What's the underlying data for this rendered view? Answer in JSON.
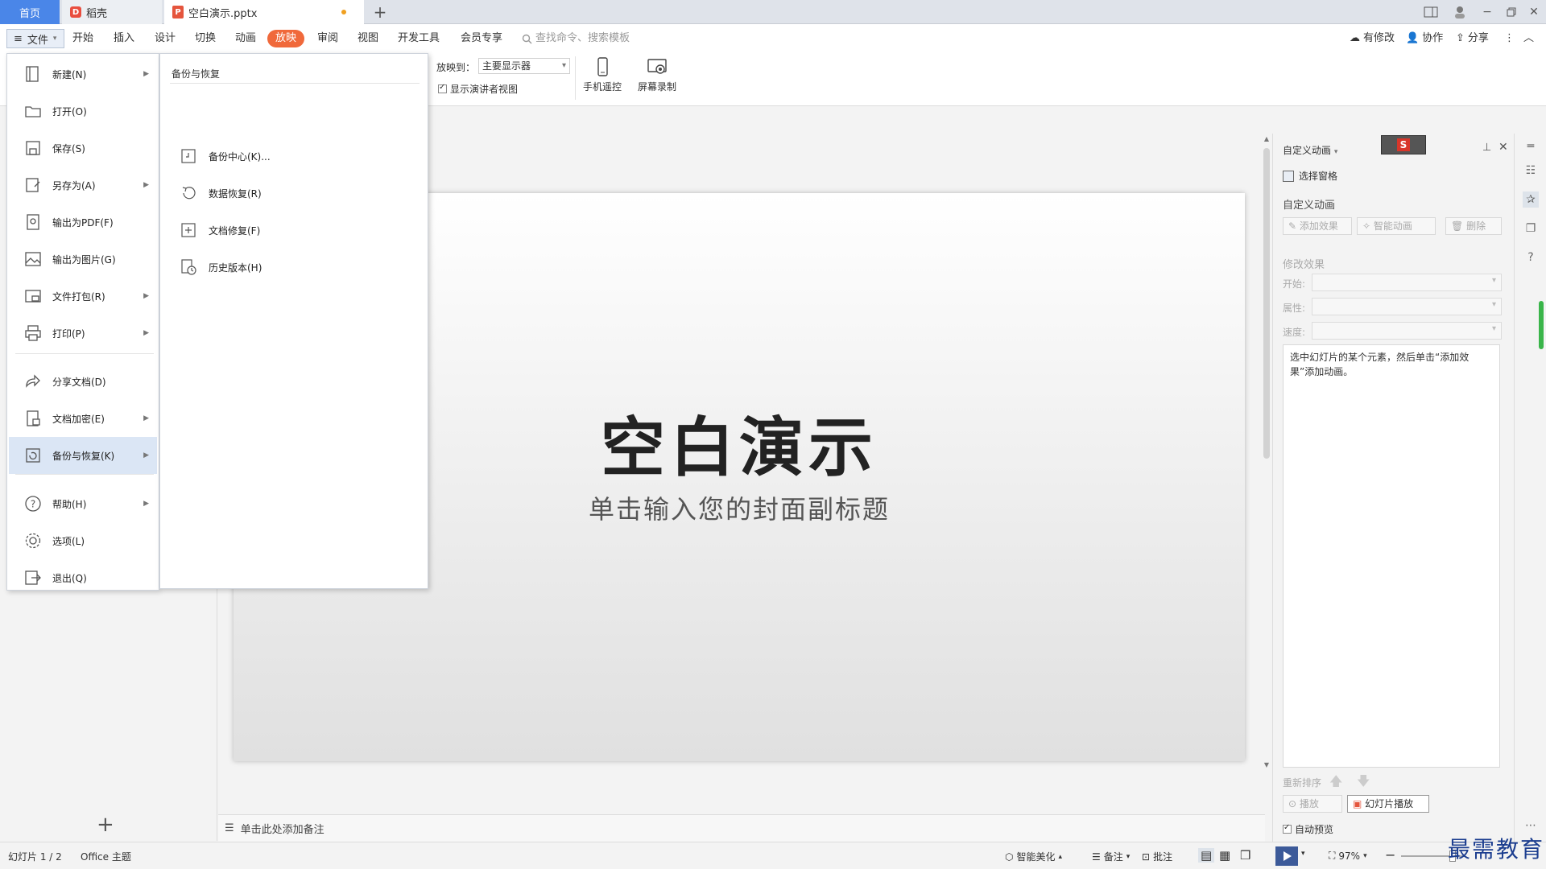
{
  "tabs": {
    "home": "首页",
    "daoke": "稻壳",
    "doc": "空白演示.pptx"
  },
  "menubar": {
    "file": "文件",
    "items": [
      "开始",
      "插入",
      "设计",
      "切换",
      "动画",
      "放映",
      "审阅",
      "视图",
      "开发工具",
      "会员专享"
    ],
    "active_index": 5,
    "search_placeholder": "查找命令、搜索模板",
    "right_actions": [
      "有修改",
      "协作",
      "分享"
    ]
  },
  "ribbon": {
    "project_to_label": "放映到：",
    "project_to_value": "主要显示器",
    "presenter_view_label": "显示演讲者视图",
    "phone_remote": "手机遥控",
    "screen_record": "屏幕录制"
  },
  "file_menu": {
    "items": [
      {
        "label": "新建(N)",
        "icon": "new-doc-icon",
        "has_sub": true
      },
      {
        "label": "打开(O)",
        "icon": "open-folder-icon",
        "has_sub": false
      },
      {
        "label": "保存(S)",
        "icon": "save-icon",
        "has_sub": false
      },
      {
        "label": "另存为(A)",
        "icon": "save-as-icon",
        "has_sub": true
      },
      {
        "label": "输出为PDF(F)",
        "icon": "pdf-icon",
        "has_sub": false
      },
      {
        "label": "输出为图片(G)",
        "icon": "image-icon",
        "has_sub": false
      },
      {
        "label": "文件打包(R)",
        "icon": "package-icon",
        "has_sub": true
      },
      {
        "label": "打印(P)",
        "icon": "print-icon",
        "has_sub": true
      },
      {
        "label": "分享文档(D)",
        "icon": "share-icon",
        "has_sub": false
      },
      {
        "label": "文档加密(E)",
        "icon": "lock-icon",
        "has_sub": true
      },
      {
        "label": "备份与恢复(K)",
        "icon": "backup-icon",
        "has_sub": true
      },
      {
        "label": "帮助(H)",
        "icon": "help-icon",
        "has_sub": true
      },
      {
        "label": "选项(L)",
        "icon": "gear-icon",
        "has_sub": false
      },
      {
        "label": "退出(Q)",
        "icon": "exit-icon",
        "has_sub": false
      }
    ],
    "selected_index": 10
  },
  "submenu": {
    "title": "备份与恢复",
    "items": [
      "备份中心(K)...",
      "数据恢复(R)",
      "文档修复(F)",
      "历史版本(H)"
    ]
  },
  "slide": {
    "title": "空白演示",
    "subtitle": "单击输入您的封面副标题"
  },
  "notes_placeholder": "单击此处添加备注",
  "anim_panel": {
    "header": "自定义动画",
    "select_pane": "选择窗格",
    "section_title": "自定义动画",
    "add_effect": "添加效果",
    "smart_anim": "智能动画",
    "delete": "删除",
    "modify_title": "修改效果",
    "start_label": "开始:",
    "property_label": "属性:",
    "speed_label": "速度:",
    "hint": "选中幻灯片的某个元素，然后单击“添加效果”添加动画。",
    "reorder": "重新排序",
    "play": "播放",
    "slideshow": "幻灯片播放",
    "auto_preview": "自动预览"
  },
  "statusbar": {
    "slide_info": "幻灯片 1 / 2",
    "theme": "Office 主题",
    "smart_beautify": "智能美化",
    "notes": "备注",
    "comments": "批注",
    "zoom": "97%"
  },
  "watermark": "最需教育",
  "colors": {
    "accent": "#4a86e8",
    "active_tab": "#f0693b",
    "selected_item": "#dbe6f5"
  }
}
